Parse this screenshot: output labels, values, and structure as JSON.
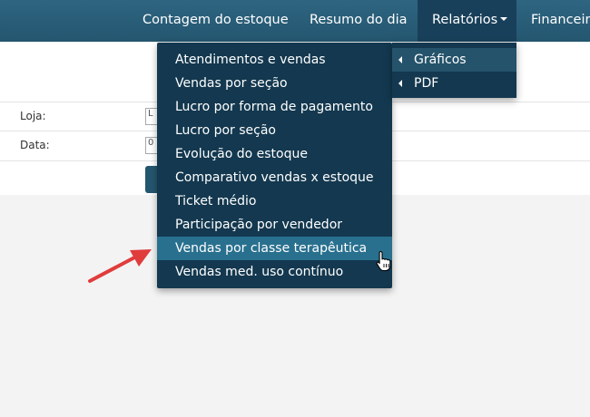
{
  "navbar": {
    "items": [
      {
        "label": "Contagem do estoque"
      },
      {
        "label": "Resumo do dia"
      },
      {
        "label": "Relatórios",
        "active": true
      },
      {
        "label": "Financeiro"
      }
    ]
  },
  "form": {
    "fields": [
      {
        "label": "Loja:",
        "value": "L"
      },
      {
        "label": "Data:",
        "value": "0"
      }
    ]
  },
  "dropdown": {
    "items": [
      {
        "label": "Atendimentos e vendas"
      },
      {
        "label": "Vendas por seção"
      },
      {
        "label": "Lucro por forma de pagamento"
      },
      {
        "label": "Lucro por seção"
      },
      {
        "label": "Evolução do estoque"
      },
      {
        "label": "Comparativo vendas x estoque"
      },
      {
        "label": "Ticket médio"
      },
      {
        "label": "Participação por vendedor"
      },
      {
        "label": "Vendas por classe terapêutica",
        "highlighted": true
      },
      {
        "label": "Vendas med. uso contínuo"
      }
    ]
  },
  "submenu": {
    "items": [
      {
        "label": "Gráficos",
        "hovered": true
      },
      {
        "label": "PDF"
      }
    ]
  },
  "colors": {
    "navbar": "#2a5f79",
    "menu_bg": "#13384f",
    "menu_highlight": "#29708f",
    "annotation_arrow": "#e03c3c"
  },
  "icons": {
    "submenu_caret": "caret-left-icon",
    "dropdown_caret": "caret-down-icon",
    "pointer": "hand-pointer-icon",
    "annotation": "red-arrow-icon"
  }
}
